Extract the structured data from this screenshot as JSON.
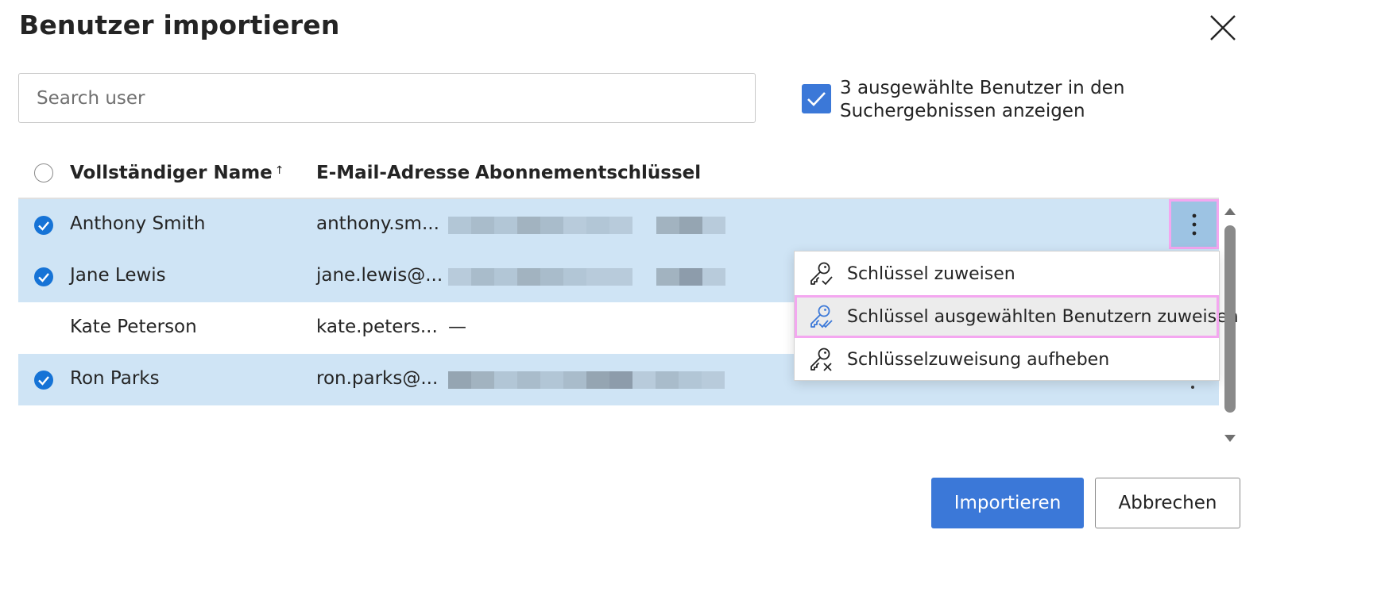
{
  "dialog": {
    "title": "Benutzer importieren",
    "close_icon": "close-icon"
  },
  "search": {
    "placeholder": "Search user",
    "value": ""
  },
  "show_selected": {
    "checked": true,
    "label": "3 ausgewählte Benutzer in den Suchergebnissen anzeigen"
  },
  "table": {
    "columns": {
      "name": "Vollständiger Name",
      "name_sort": "↑",
      "email": "E-Mail-Adresse",
      "key": "Abonnementschlüssel"
    },
    "rows": [
      {
        "selected": true,
        "name": "Anthony Smith",
        "email": "anthony.sm...",
        "key": "redacted"
      },
      {
        "selected": true,
        "name": "Jane Lewis",
        "email": "jane.lewis@...",
        "key": "redacted"
      },
      {
        "selected": false,
        "name": "Kate Peterson",
        "email": "kate.peters...",
        "key": "—"
      },
      {
        "selected": true,
        "name": "Ron Parks",
        "email": "ron.parks@...",
        "key": "redacted"
      }
    ]
  },
  "context_menu": {
    "items": [
      {
        "label": "Schlüssel zuweisen",
        "icon": "key-check-icon"
      },
      {
        "label": "Schlüssel ausgewählten Benutzern zuweisen",
        "icon": "key-double-check-icon",
        "highlighted": true
      },
      {
        "label": "Schlüsselzuweisung aufheben",
        "icon": "key-remove-icon"
      }
    ]
  },
  "footer": {
    "import_label": "Importieren",
    "cancel_label": "Abbrechen"
  },
  "colors": {
    "accent": "#3b78d8",
    "row_selected": "#cfe4f5",
    "highlight_outline": "#f4a7f0"
  }
}
